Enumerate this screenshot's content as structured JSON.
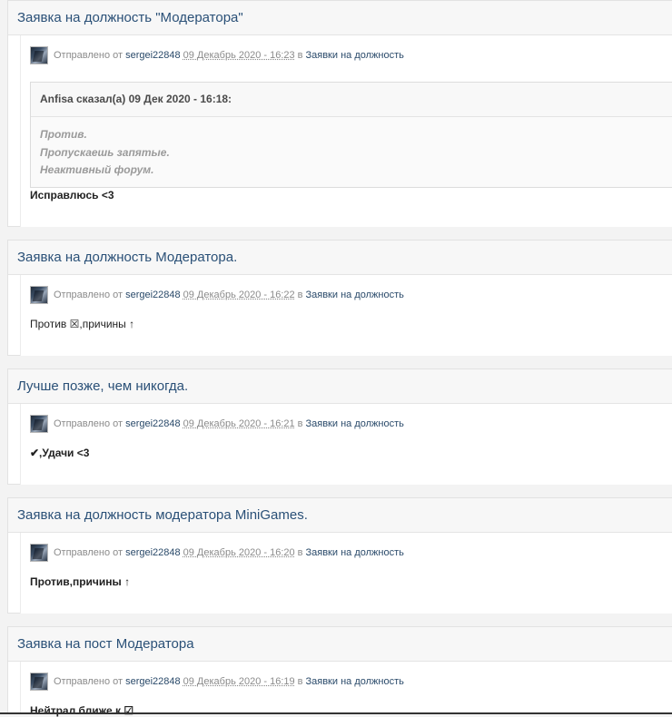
{
  "posts": [
    {
      "title": "Заявка на должность \"Модератора\"",
      "meta": {
        "prefix": "Отправлено от",
        "author": "sergei22848",
        "date": "09 Декабрь 2020 - 16:23",
        "in": "в",
        "category": "Заявки на должность"
      },
      "quote": {
        "header": "Anfisa сказал(а) 09 Дек 2020 - 16:18:",
        "lines": [
          "Против.",
          "Пропускаешь запятые.",
          "Неактивный форум."
        ]
      },
      "body": "Исправлюсь <3"
    },
    {
      "title": "Заявка на должность Модератора.",
      "meta": {
        "prefix": "Отправлено от",
        "author": "sergei22848",
        "date": "09 Декабрь 2020 - 16:22",
        "in": "в",
        "category": "Заявки на должность"
      },
      "body": "Против ☒,причины ↑"
    },
    {
      "title": "Лучше позже, чем никогда.",
      "meta": {
        "prefix": "Отправлено от",
        "author": "sergei22848",
        "date": "09 Декабрь 2020 - 16:21",
        "in": "в",
        "category": "Заявки на должность"
      },
      "body": "✔,Удачи <3"
    },
    {
      "title": "Заявка на должность модератора MiniGames.",
      "meta": {
        "prefix": "Отправлено от",
        "author": "sergei22848",
        "date": "09 Декабрь 2020 - 16:20",
        "in": "в",
        "category": "Заявки на должность"
      },
      "body": "Против,причины ↑"
    },
    {
      "title": "Заявка на пост Модератора",
      "meta": {
        "prefix": "Отправлено от",
        "author": "sergei22848",
        "date": "09 Декабрь 2020 - 16:19",
        "in": "в",
        "category": "Заявки на должность"
      },
      "body": "Нейтрал ближе к ☑"
    }
  ]
}
